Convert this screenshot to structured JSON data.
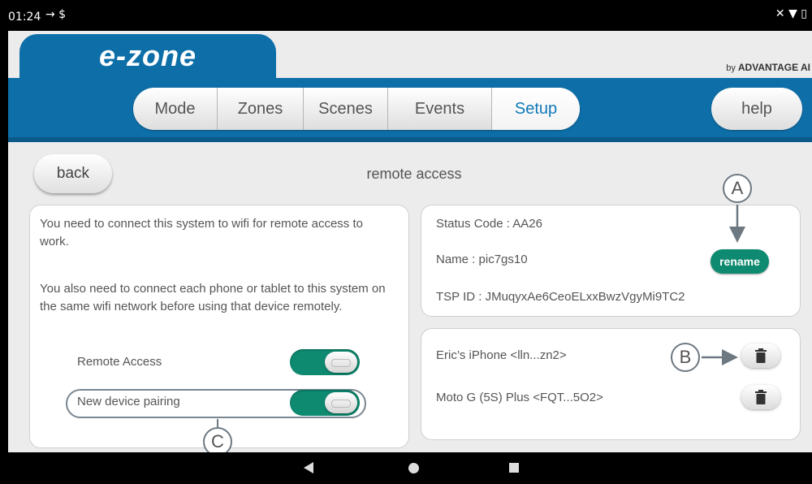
{
  "status_bar": {
    "time": "01:24",
    "left_icons": "→ $",
    "right_icons": "✕ ▼ ▯"
  },
  "header": {
    "logo": "e-zone",
    "brand_prefix": "by",
    "brand_name": "ADVANTAGE AI",
    "tabs": [
      {
        "label": "Mode",
        "active": false
      },
      {
        "label": "Zones",
        "active": false
      },
      {
        "label": "Scenes",
        "active": false
      },
      {
        "label": "Events",
        "active": false
      },
      {
        "label": "Setup",
        "active": true
      }
    ],
    "help_label": "help"
  },
  "page": {
    "back_label": "back",
    "title": "remote access"
  },
  "left_panel": {
    "intro_1": "You need to connect this system to wifi for remote access to work.",
    "intro_2": "You also need to connect each phone or tablet to this system on the same wifi network before using that device remotely.",
    "remote_access_label": "Remote Access",
    "remote_access_on": true,
    "new_device_pairing_label": "New device pairing",
    "new_device_pairing_on": true
  },
  "status_panel": {
    "status_code": "Status Code : AA26",
    "name": "Name : pic7gs10",
    "tsp_id": "TSP ID : JMuqyxAe6CeoELxxBwzVgyMi9TC2",
    "rename_label": "rename"
  },
  "devices": [
    {
      "label": "Eric’s iPhone <lln...zn2>"
    },
    {
      "label": "Moto G (5S) Plus <FQT...5O2>"
    }
  ],
  "callouts": {
    "a": "A",
    "b": "B",
    "c": "C"
  },
  "colors": {
    "header_blue": "#0e6fa8",
    "accent_green": "#0e8a70",
    "active_tab_text": "#0e79b8"
  }
}
